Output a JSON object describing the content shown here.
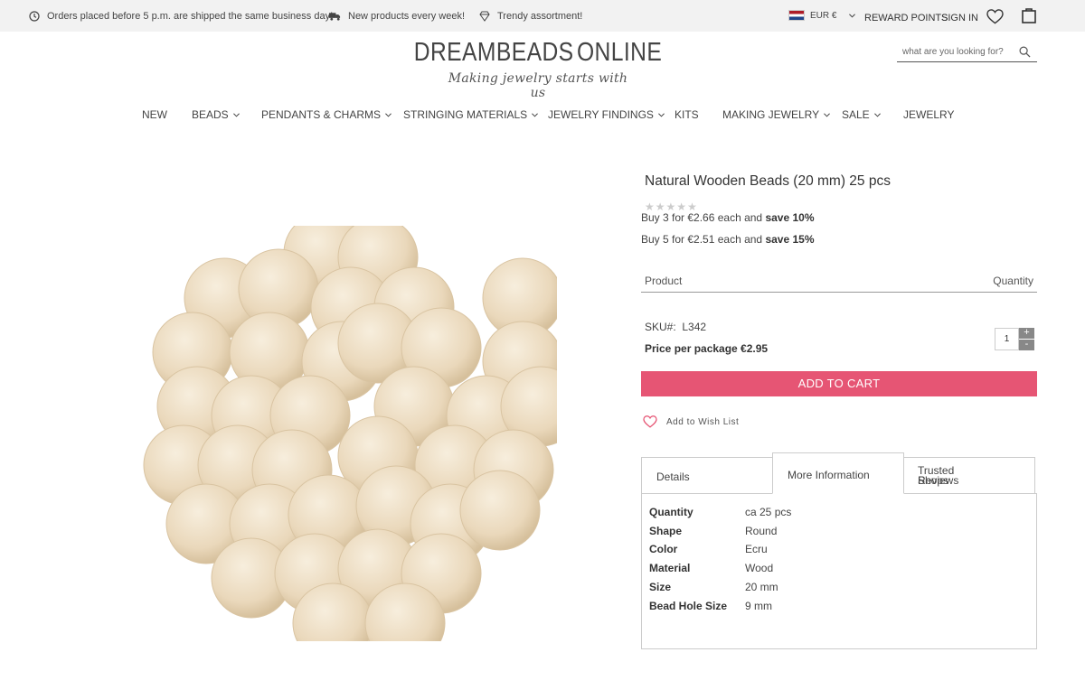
{
  "topbar": {
    "usps": [
      {
        "icon": "clock-icon",
        "text": "Orders placed before 5 p.m. are shipped the same business day!"
      },
      {
        "icon": "truck-icon",
        "text": "New products every week!"
      },
      {
        "icon": "diamond-icon",
        "text": "Trendy assortment!"
      }
    ],
    "currency": "EUR €",
    "reward_points": "REWARD POINTS",
    "sign_in": "SIGN IN"
  },
  "header": {
    "logo_left": "DREAMBEADS",
    "logo_right": "ONLINE",
    "tagline": "Making jewelry starts with us",
    "search_placeholder": "what are you looking for?"
  },
  "nav": [
    {
      "label": "NEW",
      "dropdown": false
    },
    {
      "label": "BEADS",
      "dropdown": true
    },
    {
      "label": "PENDANTS & CHARMS",
      "dropdown": true
    },
    {
      "label": "STRINGING MATERIALS",
      "dropdown": true
    },
    {
      "label": "JEWELRY FINDINGS",
      "dropdown": true
    },
    {
      "label": "KITS",
      "dropdown": false
    },
    {
      "label": "MAKING JEWELRY",
      "dropdown": true
    },
    {
      "label": "SALE",
      "dropdown": true
    },
    {
      "label": "JEWELRY",
      "dropdown": false
    }
  ],
  "product": {
    "title": "Natural Wooden Beads (20 mm) 25 pcs",
    "rating": 0,
    "tiers": [
      {
        "text": "Buy 3 for €2.66 each and ",
        "save": "save 10%"
      },
      {
        "text": "Buy 5 for €2.51 each and ",
        "save": "save 15%"
      }
    ],
    "table_product_header": "Product",
    "table_quantity_header": "Quantity",
    "sku_label": "SKU#:",
    "sku_value": "L342",
    "price_text": "Price per package €2.95",
    "quantity": "1",
    "plus": "+",
    "minus": "-",
    "add_to_cart": "ADD TO CART",
    "wish_list": "Add to Wish List"
  },
  "tabs": [
    {
      "label": "Details"
    },
    {
      "label": "More Information"
    },
    {
      "label_line1": "Trusted Shops",
      "label_line2": "Reviews"
    }
  ],
  "specs": [
    {
      "key": "Quantity",
      "value": "ca 25 pcs"
    },
    {
      "key": "Shape",
      "value": "Round"
    },
    {
      "key": "Color",
      "value": "Ecru"
    },
    {
      "key": "Material",
      "value": "Wood"
    },
    {
      "key": "Size",
      "value": "20 mm"
    },
    {
      "key": "Bead Hole Size",
      "value": "9 mm"
    }
  ],
  "colors": {
    "accent": "#e65574",
    "topbar_bg": "#f2f2f2",
    "bead": "#eee0c8"
  }
}
